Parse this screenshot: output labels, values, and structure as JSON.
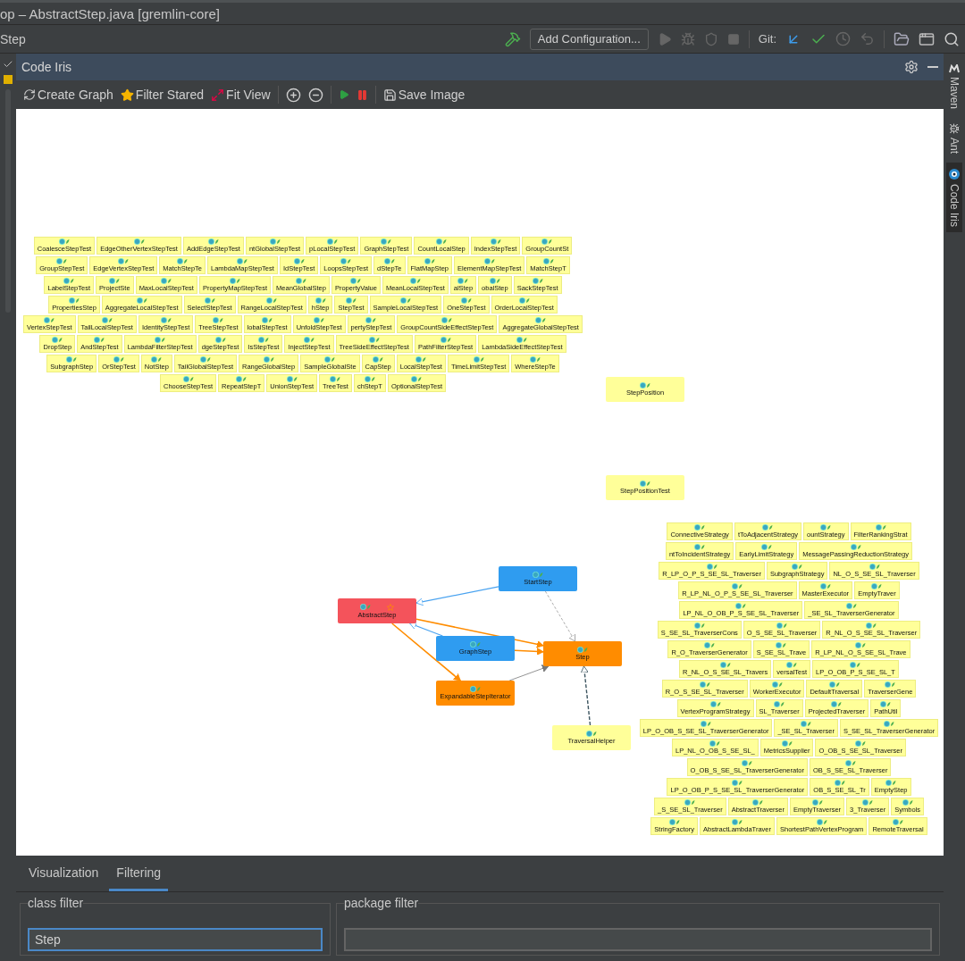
{
  "title_bar": {
    "title": "op – AbstractStep.java [gremlin-core]"
  },
  "nav_bar": {
    "breadcrumb": "Step",
    "run_config": "Add Configuration...",
    "git_label": "Git:"
  },
  "side_tabs": [
    {
      "kind": "maven",
      "label": "Maven",
      "selected": false
    },
    {
      "kind": "ant",
      "label": "Ant",
      "selected": false
    },
    {
      "kind": "iris",
      "label": "Code Iris",
      "selected": true
    }
  ],
  "panel": {
    "title": "Code Iris"
  },
  "toolbar": [
    {
      "kind": "refresh",
      "label": "Create Graph"
    },
    {
      "kind": "star",
      "label": "Filter Stared"
    },
    {
      "kind": "fit",
      "label": "Fit View"
    },
    {
      "kind": "zoom_in"
    },
    {
      "kind": "zoom_out"
    },
    {
      "kind": "play"
    },
    {
      "kind": "pause"
    },
    {
      "kind": "save",
      "label": "Save Image"
    }
  ],
  "graph": {
    "nodes": [
      {
        "label": "AbstractStep",
        "color": "#f4535b",
        "starred": true
      },
      {
        "label": "StartStep",
        "color": "#2f9cf0",
        "starred": false
      },
      {
        "label": "GraphStep",
        "color": "#2f9cf0",
        "starred": false
      },
      {
        "label": "Step",
        "color": "#ff8c00",
        "starred": false
      },
      {
        "label": "ExpandableStepIterator",
        "color": "#ff8c00",
        "starred": false
      },
      {
        "label": "StepPosition",
        "color": "#ffff99",
        "starred": false
      },
      {
        "label": "StepPositionTest",
        "color": "#ffff99",
        "starred": false
      },
      {
        "label": "TraversalHelper",
        "color": "#ffff99",
        "starred": false
      }
    ],
    "clusters": [
      {
        "labels": [
          "CoalesceStepTest",
          "EdgeOtherVertexStepTest",
          "AddEdgeStepTest",
          "ntGlobalStepTest",
          "pLocalStepTest",
          "GraphStepTest",
          "CountLocalStep",
          "IndexStepTest",
          "GroupCountSt",
          "GroupStepTest",
          "EdgeVertexStepTest",
          "MatchStepTe",
          "LambdaMapStepTest",
          "IdStepTest",
          "LoopsStepTest",
          "dStepTe",
          "FlatMapStep",
          "ElementMapStepTest",
          "MatchStepT",
          "LabelStepTest",
          "ProjectSte",
          "MaxLocalStepTest",
          "PropertyMapStepTest",
          "MeanGlobalStep",
          "PropertyValue",
          "MeanLocalStepTest",
          "alStep",
          "obalStep",
          "SackStepTest",
          "PropertiesStep",
          "AggregateLocalStepTest",
          "SelectStepTest",
          "RangeLocalStepTest",
          "hStep",
          "StepTest",
          "SampleLocalStepTest",
          "OneStepTest",
          "OrderLocalStepTest",
          "VertexStepTest",
          "TailLocalStepTest",
          "IdentityStepTest",
          "TreeStepTest",
          "lobalStepTest",
          "UnfoldStepTest",
          "pertyStepTest",
          "GroupCountSideEffectStepTest",
          "AggregateGlobalStepTest",
          "DropStep",
          "AndStepTest",
          "LambdaFilterStepTest",
          "dgeStepTest",
          "IsStepTest",
          "InjectStepTest",
          "TreeSideEffectStepTest",
          "PathFilterStepTest",
          "LambdaSideEffectStepTest",
          "SubgraphStep",
          "OrStepTest",
          "NotStep",
          "TailGlobalStepTest",
          "RangeGlobalStep",
          "SampleGlobalSte",
          "CapStep",
          "LocalStepTest",
          "TimeLimitStepTest",
          "WhereStepTe",
          "ChooseStepTest",
          "RepeatStepT",
          "UnionStepTest",
          "TreeTest",
          "chStepT",
          "OptionalStepTest"
        ]
      },
      {
        "labels": [
          "ConnectiveStrategy",
          "tToAdjacentStrategy",
          "ountStrategy",
          "FilterRankingStrat",
          "ntToIncidentStrategy",
          "EarlyLimitStrategy",
          "MessagePassingReductionStrategy",
          "R_LP_O_P_S_SE_SL_Traverser",
          "SubgraphStrategy",
          "NL_O_S_SE_SL_Traverser",
          "R_LP_NL_O_P_S_SE_SL_Traverser",
          "MasterExecutor",
          "EmptyTraver",
          "LP_NL_O_OB_P_S_SE_SL_Traverser",
          "_SE_SL_TraverserGenerator",
          "S_SE_SL_TraverserCons",
          "O_S_SE_SL_Traverser",
          "R_NL_O_S_SE_SL_Traverser",
          "R_O_TraverserGenerator",
          "S_SE_SL_Trave",
          "R_LP_NL_O_S_SE_SL_Trave",
          "R_NL_O_S_SE_SL_Travers",
          "versalTest",
          "LP_O_OB_P_S_SE_SL_T",
          "R_O_S_SE_SL_Traverser",
          "WorkerExecutor",
          "DefaultTraversal",
          "TraverserGene",
          "VertexProgramStrategy",
          "SL_Traverser",
          "ProjectedTraverser",
          "PathUtil",
          "LP_O_OB_S_SE_SL_TraverserGenerator",
          "_SE_SL_Traverser",
          "S_SE_SL_TraverserGenerator",
          "LP_NL_O_OB_S_SE_SL_",
          "MetricsSupplier",
          "O_OB_S_SE_SL_Traverser",
          "O_OB_S_SE_SL_TraverserGenerator",
          "OB_S_SE_SL_Traverser",
          "LP_O_OB_P_S_SE_SL_TraverserGenerator",
          "OB_S_SE_SL_Tr",
          "EmptyStep",
          "_S_SE_SL_Traverser",
          "AbstractTraverser",
          "EmptyTraverser",
          "3_Traverser",
          "Symbols",
          "StringFactory",
          "AbstractLambdaTraver",
          "ShortestPathVertexProgram",
          "RemoteTraversal"
        ]
      }
    ]
  },
  "bottom_tabs": [
    {
      "label": "Visualization",
      "selected": false
    },
    {
      "label": "Filtering",
      "selected": true
    }
  ],
  "filters": [
    {
      "label": "class filter",
      "value": "Step",
      "focused": true
    },
    {
      "label": "package filter",
      "focused": false
    }
  ]
}
